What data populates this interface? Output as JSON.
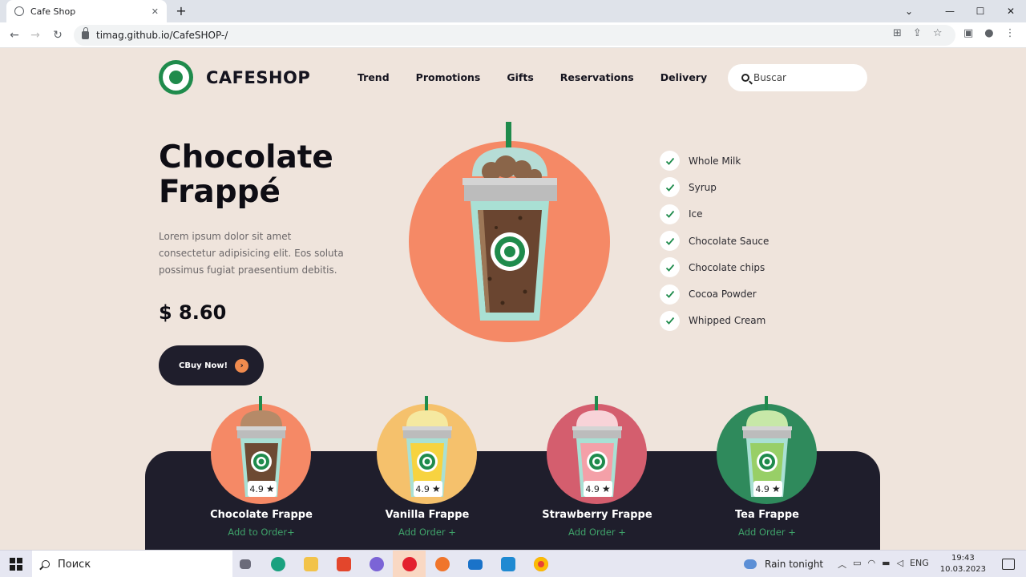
{
  "browser": {
    "tab_title": "Cafe Shop",
    "tab_close": "✕",
    "new_tab": "+",
    "url": "timag.github.io/CafeSHOP-/"
  },
  "site": {
    "brand": "CAFESHOP",
    "nav": [
      "Trend",
      "Promotions",
      "Gifts",
      "Reservations",
      "Delivery"
    ],
    "search_placeholder": "Buscar"
  },
  "hero": {
    "title_line1": "Chocolate",
    "title_line2": "Frappé",
    "description": "Lorem ipsum dolor sit amet consectetur adipisicing elit. Eos soluta possimus fugiat praesentium debitis.",
    "price": "$ 8.60",
    "buy_label": "CBuy Now!",
    "ingredients": [
      "Whole Milk",
      "Syrup",
      "Ice",
      "Chocolate Sauce",
      "Chocolate chips",
      "Cocoa Powder",
      "Whipped Cream"
    ]
  },
  "products": [
    {
      "name": "Chocolate Frappe",
      "rating": "4.9",
      "add": "Add to Order+",
      "circle": "#f58966",
      "drink": "#6d4a33",
      "cream": "#b58a68"
    },
    {
      "name": "Vanilla Frappe",
      "rating": "4.9",
      "add": "Add Order +",
      "circle": "#f5c16c",
      "drink": "#f7d340",
      "cream": "#f5e9a0"
    },
    {
      "name": "Strawberry Frappe",
      "rating": "4.9",
      "add": "Add Order +",
      "circle": "#d45e6e",
      "drink": "#f4a0a8",
      "cream": "#f8d3d8"
    },
    {
      "name": "Tea Frappe",
      "rating": "4.9",
      "add": "Add Order +",
      "circle": "#2f8a5c",
      "drink": "#98cf67",
      "cream": "#c7e8a8"
    }
  ],
  "taskbar": {
    "search_text": "Поиск",
    "weather": "Rain tonight",
    "lang": "ENG",
    "time": "19:43",
    "date": "10.03.2023"
  },
  "colors": {
    "accent_green": "#1f8b4c",
    "dark": "#1f1e2c",
    "orange": "#f08b4e"
  }
}
